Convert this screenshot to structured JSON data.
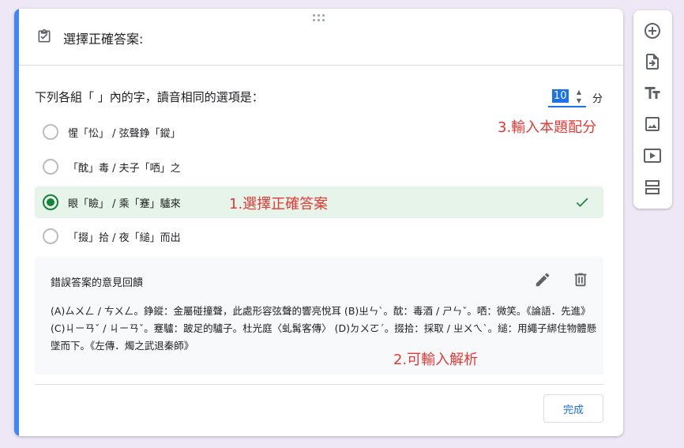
{
  "header": {
    "title": "選擇正確答案:",
    "icon": "assignment-check-icon"
  },
  "question": {
    "text": "下列各組「  」內的字，讀音相同的選項是："
  },
  "points": {
    "value": "10",
    "unit": "分"
  },
  "options": [
    {
      "label": "惺「忪」 / 弦聲錚「鏦」",
      "selected": false
    },
    {
      "label": "「酖」毒 / 夫子「哂」之",
      "selected": false
    },
    {
      "label": "眼「瞼」 / 乘「蹇」驢來",
      "selected": true
    },
    {
      "label": "「掇」拾 / 夜「縋」而出",
      "selected": false
    }
  ],
  "annotations": {
    "step1": "1.選擇正確答案",
    "step2": "2.可輸入解析",
    "step3": "3.輸入本題配分"
  },
  "feedback": {
    "title": "錯誤答案的意見回饋",
    "body": "(A)ㄙㄨㄥ / ㄘㄨㄥ。錚鏦：金屬碰撞聲，此處形容弦聲的響亮悅耳 (B)ㄓㄣˋ。酖：毒酒 / ㄕㄣˇ。哂：微笑。《論語．先進》 (C)ㄐㄧㄢˇ / ㄐㄧㄢˇ。蹇驢：跛足的驢子。杜光庭〈虬髯客傳〉 (D)ㄉㄨㄛˊ。掇拾：採取 / ㄓㄨㄟˋ。縋：用繩子綁住物體懸墜而下。《左傳．燭之武退秦師》"
  },
  "done_label": "完成",
  "toolbar": [
    {
      "name": "add-question-button",
      "icon": "add-circle-icon"
    },
    {
      "name": "import-questions-button",
      "icon": "import-icon"
    },
    {
      "name": "add-title-button",
      "icon": "title-text-icon"
    },
    {
      "name": "add-image-button",
      "icon": "image-icon"
    },
    {
      "name": "add-video-button",
      "icon": "video-icon"
    },
    {
      "name": "add-section-button",
      "icon": "section-icon"
    }
  ],
  "colors": {
    "accent": "#4285f4",
    "selected_bg": "#e6f4ea",
    "correct": "#188038",
    "annotation": "#e53935",
    "primary": "#1a73e8"
  }
}
